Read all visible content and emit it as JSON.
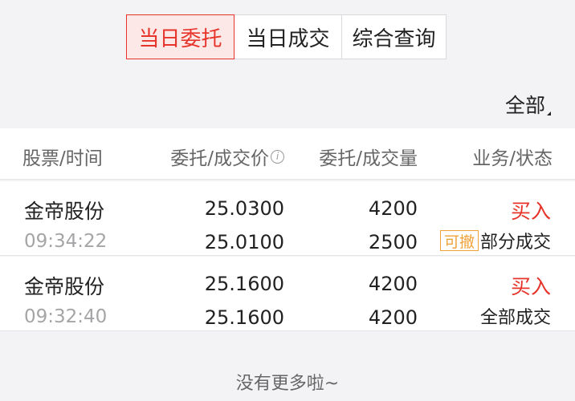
{
  "tabs": [
    {
      "label": "当日委托",
      "active": true
    },
    {
      "label": "当日成交",
      "active": false
    },
    {
      "label": "综合查询",
      "active": false
    }
  ],
  "filter": {
    "label": "全部"
  },
  "table": {
    "headers": {
      "stock_time": "股票/时间",
      "price": "委托/成交价",
      "qty": "委托/成交量",
      "status": "业务/状态"
    },
    "info_icon_glyph": "i",
    "rows": [
      {
        "stock": "金帝股份",
        "time": "09:34:22",
        "order_price": "25.0300",
        "deal_price": "25.0100",
        "order_qty": "4200",
        "deal_qty": "2500",
        "side": "买入",
        "cancel_tag": "可撤",
        "status": "部分成交"
      },
      {
        "stock": "金帝股份",
        "time": "09:32:40",
        "order_price": "25.1600",
        "deal_price": "25.1600",
        "order_qty": "4200",
        "deal_qty": "4200",
        "side": "买入",
        "status": "全部成交"
      }
    ]
  },
  "footer": {
    "text": "没有更多啦~"
  },
  "colors": {
    "accent_red": "#e7342b",
    "tag_orange": "#f0a23a",
    "background": "#f3f3f5"
  }
}
